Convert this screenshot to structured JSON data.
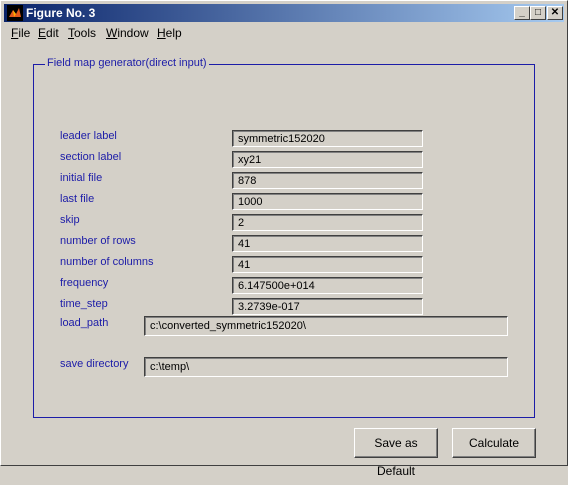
{
  "window": {
    "title": "Figure No. 3",
    "controls": {
      "minimize": "_",
      "maximize": "□",
      "close": "✕"
    }
  },
  "menu": [
    {
      "label": "File",
      "mnemonic": "F",
      "rest": "ile"
    },
    {
      "label": "Edit",
      "mnemonic": "E",
      "rest": "dit"
    },
    {
      "label": "Tools",
      "mnemonic": "T",
      "rest": "ools"
    },
    {
      "label": "Window",
      "mnemonic": "W",
      "rest": "indow"
    },
    {
      "label": "Help",
      "mnemonic": "H",
      "rest": "elp"
    }
  ],
  "panel": {
    "title": "Field map generator(direct input)"
  },
  "fields": {
    "leader_label": {
      "label": "leader label",
      "value": "symmetric152020"
    },
    "section_label": {
      "label": "section label",
      "value": "xy21"
    },
    "initial_file": {
      "label": "initial file",
      "value": "878"
    },
    "last_file": {
      "label": "last file",
      "value": "1000"
    },
    "skip": {
      "label": "skip",
      "value": "2"
    },
    "number_of_rows": {
      "label": "number of rows",
      "value": "41"
    },
    "number_of_columns": {
      "label": "number of columns",
      "value": "41"
    },
    "frequency": {
      "label": "frequency",
      "value": "6.147500e+014"
    },
    "time_step": {
      "label": "time_step",
      "value": "3.2739e-017"
    },
    "load_path": {
      "label": "load_path",
      "value": "c:\\converted_symmetric152020\\"
    },
    "save_directory": {
      "label": "save directory",
      "value": "c:\\temp\\"
    }
  },
  "buttons": {
    "save_default": "Save as Default",
    "calculate": "Calculate"
  },
  "icons": {
    "app_icon": "matlab-logo-icon"
  }
}
